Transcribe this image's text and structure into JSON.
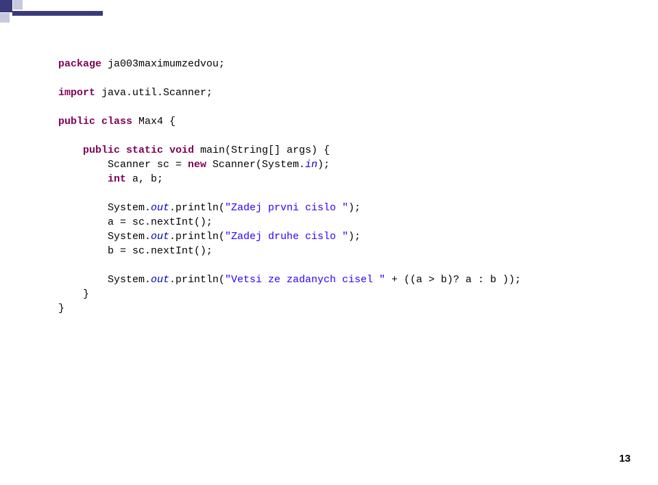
{
  "code": {
    "kw_package": "package",
    "pkg_name": " ja003maximumzedvou;",
    "kw_import": "import",
    "import_name": " java.util.Scanner;",
    "kw_public1": "public",
    "kw_class": "class",
    "class_name": " Max4 {",
    "kw_public2": "public",
    "kw_static": "static",
    "kw_void": "void",
    "main_sig": " main(String[] args) {",
    "scanner_decl1": "        Scanner sc = ",
    "kw_new": "new",
    "scanner_decl2": " Scanner(System.",
    "sys_in": "in",
    "scanner_decl3": ");",
    "kw_int": "int",
    "int_vars": " a, b;",
    "sout1a": "        System.",
    "sout1b": "out",
    "sout1c": ".println(",
    "str1": "\"Zadej prvni cislo \"",
    "sout1d": ");",
    "assign_a": "        a = sc.nextInt();",
    "sout2a": "        System.",
    "sout2b": "out",
    "sout2c": ".println(",
    "str2": "\"Zadej druhe cislo \"",
    "sout2d": ");",
    "assign_b": "        b = sc.nextInt();",
    "sout3a": "        System.",
    "sout3b": "out",
    "sout3c": ".println(",
    "str3": "\"Vetsi ze zadanych cisel \"",
    "sout3d": " + ((a > b)? a : b ));",
    "close1": "    }",
    "close2": "}"
  },
  "page_number": "13"
}
